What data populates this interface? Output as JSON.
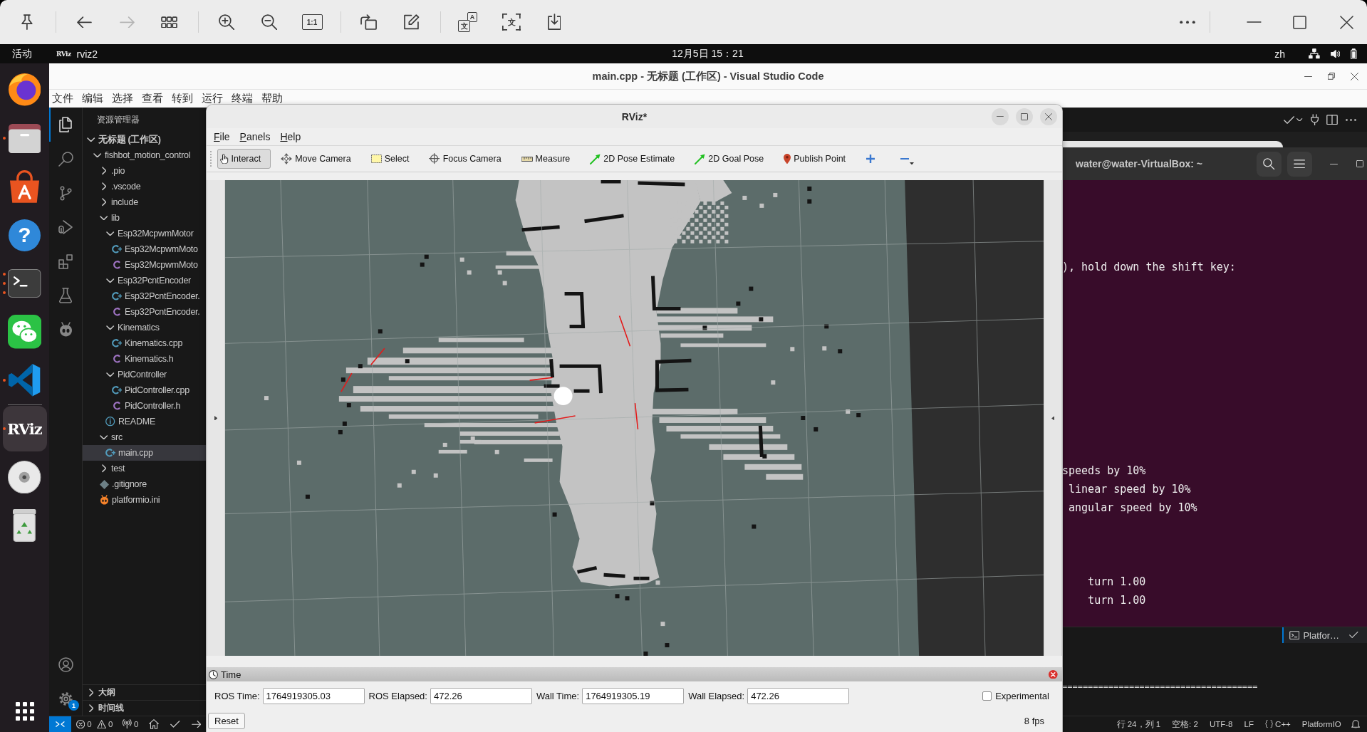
{
  "viewer_toolbar": {
    "groups": [
      [
        {
          "kind": "pin",
          "disabled": false
        }
      ],
      [
        {
          "kind": "back",
          "disabled": false
        },
        {
          "kind": "forward",
          "disabled": true
        },
        {
          "kind": "thumbnails",
          "disabled": false
        }
      ],
      [
        {
          "kind": "zoom-in",
          "disabled": false
        },
        {
          "kind": "zoom-out",
          "disabled": false
        },
        {
          "kind": "actual-size",
          "glyphs": [
            "1:1"
          ],
          "disabled": false
        }
      ],
      [
        {
          "kind": "rotate",
          "disabled": false
        },
        {
          "kind": "edit",
          "disabled": false
        }
      ],
      [
        {
          "kind": "translate",
          "glyphs": [
            "文",
            "A"
          ],
          "disabled": false
        },
        {
          "kind": "ocr",
          "glyphs": [
            "文"
          ],
          "disabled": false
        },
        {
          "kind": "save",
          "disabled": false
        }
      ]
    ]
  },
  "top_bar": {
    "activities": "活动",
    "app_logo": "RViz",
    "app_name": "rviz2",
    "clock": "12月5日 15：21",
    "input_method": "zh"
  },
  "dock": {
    "favorites": [
      {
        "kind": "firefox",
        "running": false,
        "several_windows": false,
        "selected": false
      },
      {
        "kind": "files",
        "running": true,
        "several_windows": false,
        "selected": false
      },
      {
        "kind": "software",
        "running": false,
        "several_windows": false,
        "selected": false
      },
      {
        "kind": "help",
        "glyph": "?",
        "running": false,
        "several_windows": false,
        "selected": false
      },
      {
        "kind": "terminal",
        "running": true,
        "several_windows": true,
        "selected": false
      },
      {
        "kind": "wechat",
        "running": false,
        "several_windows": false,
        "selected": false
      },
      {
        "kind": "vscode",
        "running": true,
        "several_windows": false,
        "selected": false
      }
    ],
    "others": [
      {
        "kind": "rviz",
        "glyph": "RViz",
        "running": true,
        "several_windows": false,
        "selected": true
      },
      {
        "kind": "disc",
        "running": false,
        "several_windows": false,
        "selected": false
      },
      {
        "kind": "trash",
        "running": false,
        "several_windows": false,
        "selected": false
      }
    ]
  },
  "vscode": {
    "title": "main.cpp - 无标题 (工作区) - Visual Studio Code",
    "menu": [
      "文件",
      "编辑",
      "选择",
      "查看",
      "转到",
      "运行",
      "终端",
      "帮助"
    ],
    "activity_bar": [
      {
        "kind": "explorer",
        "selected": true
      },
      {
        "kind": "search",
        "selected": false
      },
      {
        "kind": "source-control",
        "selected": false
      },
      {
        "kind": "run-debug",
        "selected": false
      },
      {
        "kind": "extensions",
        "selected": false
      },
      {
        "kind": "testing",
        "selected": false
      },
      {
        "kind": "platformio",
        "selected": false
      }
    ],
    "settings_badge": "1",
    "explorer": {
      "title": "资源管理器",
      "tree": [
        {
          "label": "无标题 (工作区)",
          "kind": "workspace",
          "expanded": true,
          "selected": false,
          "children": [
            {
              "label": "fishbot_motion_control",
              "kind": "folder",
              "expanded": true,
              "selected": false,
              "children": [
                {
                  "label": ".pio",
                  "kind": "folder",
                  "expanded": false,
                  "selected": false
                },
                {
                  "label": ".vscode",
                  "kind": "folder",
                  "expanded": false,
                  "selected": false
                },
                {
                  "label": "include",
                  "kind": "folder",
                  "expanded": false,
                  "selected": false
                },
                {
                  "label": "lib",
                  "kind": "folder",
                  "expanded": true,
                  "selected": false,
                  "children": [
                    {
                      "label": "Esp32McpwmMotor",
                      "kind": "folder",
                      "expanded": true,
                      "selected": false,
                      "children": [
                        {
                          "label": "Esp32McpwmMoto",
                          "kind": "cpp",
                          "selected": false
                        },
                        {
                          "label": "Esp32McpwmMoto",
                          "kind": "h",
                          "selected": false
                        }
                      ]
                    },
                    {
                      "label": "Esp32PcntEncoder",
                      "kind": "folder",
                      "expanded": true,
                      "selected": false,
                      "children": [
                        {
                          "label": "Esp32PcntEncoder.",
                          "kind": "cpp",
                          "selected": false
                        },
                        {
                          "label": "Esp32PcntEncoder.",
                          "kind": "h",
                          "selected": false
                        }
                      ]
                    },
                    {
                      "label": "Kinematics",
                      "kind": "folder",
                      "expanded": true,
                      "selected": false,
                      "children": [
                        {
                          "label": "Kinematics.cpp",
                          "kind": "cpp",
                          "selected": false
                        },
                        {
                          "label": "Kinematics.h",
                          "kind": "h",
                          "selected": false
                        }
                      ]
                    },
                    {
                      "label": "PidController",
                      "kind": "folder",
                      "expanded": true,
                      "selected": false,
                      "children": [
                        {
                          "label": "PidController.cpp",
                          "kind": "cpp",
                          "selected": false
                        },
                        {
                          "label": "PidController.h",
                          "kind": "h",
                          "selected": false
                        }
                      ]
                    },
                    {
                      "label": "README",
                      "kind": "info",
                      "selected": false
                    }
                  ]
                },
                {
                  "label": "src",
                  "kind": "folder",
                  "expanded": true,
                  "selected": false,
                  "children": [
                    {
                      "label": "main.cpp",
                      "kind": "cpp",
                      "selected": true
                    }
                  ]
                },
                {
                  "label": "test",
                  "kind": "folder",
                  "expanded": false,
                  "selected": false
                },
                {
                  "label": ".gitignore",
                  "kind": "git",
                  "selected": false
                },
                {
                  "label": "platformio.ini",
                  "kind": "platformio",
                  "selected": false
                }
              ]
            }
          ]
        }
      ],
      "sections": [
        {
          "label": "大纲",
          "expanded": false
        },
        {
          "label": "时间线",
          "expanded": false
        }
      ]
    },
    "panel": {
      "output": "======================================",
      "tab": "Platfor…"
    },
    "status_bar": {
      "errors": "0",
      "warnings": "0",
      "ports": "0",
      "right": [
        {
          "kind": "text",
          "text": "行 24，列 1"
        },
        {
          "kind": "text",
          "text": "空格: 2"
        },
        {
          "kind": "text",
          "text": "UTF-8"
        },
        {
          "kind": "text",
          "text": "LF"
        },
        {
          "kind": "language",
          "text": "C++"
        },
        {
          "kind": "text",
          "text": "PlatformIO"
        }
      ]
    }
  },
  "terminal": {
    "title": "water@water-VirtualBox: ~",
    "blocks": [
      [
        "), hold down the shift key:"
      ],
      [
        "speeds by 10%",
        " linear speed by 10%",
        " angular speed by 10%"
      ],
      [
        "    turn 1.00",
        "    turn 1.00"
      ]
    ]
  },
  "rviz": {
    "title": "RViz*",
    "menu": [
      "File",
      "Panels",
      "Help"
    ],
    "tools": [
      {
        "kind": "interact",
        "label": "Interact",
        "selected": true
      },
      {
        "kind": "move-camera",
        "label": "Move Camera",
        "selected": false
      },
      {
        "kind": "select",
        "label": "Select",
        "selected": false
      },
      {
        "kind": "focus-camera",
        "label": "Focus Camera",
        "selected": false
      },
      {
        "kind": "measure",
        "label": "Measure",
        "selected": false
      },
      {
        "kind": "pose-estimate",
        "label": "2D Pose Estimate",
        "selected": false
      },
      {
        "kind": "goal-pose",
        "label": "2D Goal Pose",
        "selected": false
      },
      {
        "kind": "publish-point",
        "label": "Publish Point",
        "selected": false
      }
    ],
    "time_panel": {
      "title": "Time",
      "fields": [
        {
          "label": "ROS Time:",
          "value": "1764919305.03"
        },
        {
          "label": "ROS Elapsed:",
          "value": "472.26"
        },
        {
          "label": "Wall Time:",
          "value": "1764919305.19"
        },
        {
          "label": "Wall Elapsed:",
          "value": "472.26"
        }
      ],
      "experimental": {
        "label": "Experimental",
        "checked": false
      }
    },
    "reset": "Reset",
    "fps": "8 fps"
  }
}
